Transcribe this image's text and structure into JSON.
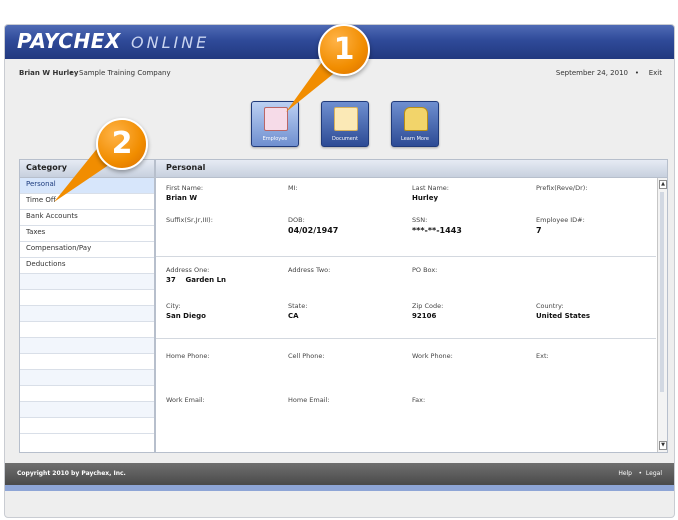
{
  "app": {
    "logo_text": "PAYCHEX",
    "logo_suffix": "ONLINE"
  },
  "userbar": {
    "user": "Brian W Hurley",
    "separator": "•",
    "company": "Sample Training Company",
    "date": "September 24, 2010",
    "exit": "Exit"
  },
  "icons": [
    {
      "label": "Employee",
      "icon": "employee-icon",
      "selected": true
    },
    {
      "label": "Document",
      "icon": "document-icon",
      "selected": false
    },
    {
      "label": "Learn More",
      "icon": "book-icon",
      "selected": false
    }
  ],
  "category": {
    "title": "Category",
    "items": [
      "Personal",
      "Time Off",
      "Bank Accounts",
      "Taxes",
      "Compensation/Pay",
      "Deductions"
    ],
    "selected": "Personal"
  },
  "panel": {
    "title": "Personal",
    "fields": {
      "first_name": {
        "label": "First Name:",
        "value": "Brian W"
      },
      "mi": {
        "label": "MI:",
        "value": ""
      },
      "last_name": {
        "label": "Last Name:",
        "value": "Hurley"
      },
      "prefix": {
        "label": "Prefix(Reve/Dr):",
        "value": ""
      },
      "suffix": {
        "label": "Suffix(Sr,Jr,III):",
        "value": ""
      },
      "dob": {
        "label": "DOB:",
        "value": "04/02/1947"
      },
      "ssn": {
        "label": "SSN:",
        "value": "***-**-1443"
      },
      "employee_id": {
        "label": "Employee ID#:",
        "value": "7"
      },
      "address_one": {
        "label": "Address One:",
        "value": "37    Garden Ln"
      },
      "address_two": {
        "label": "Address Two:",
        "value": ""
      },
      "po_box": {
        "label": "PO Box:",
        "value": ""
      },
      "city": {
        "label": "City:",
        "value": "San Diego"
      },
      "state": {
        "label": "State:",
        "value": "CA"
      },
      "zip": {
        "label": "Zip Code:",
        "value": "92106"
      },
      "country": {
        "label": "Country:",
        "value": "United States"
      },
      "home_phone": {
        "label": "Home Phone:"
      },
      "cell_phone": {
        "label": "Cell Phone:"
      },
      "work_phone": {
        "label": "Work Phone:"
      },
      "ext": {
        "label": "Ext:"
      },
      "work_email": {
        "label": "Work Email:"
      },
      "home_email": {
        "label": "Home Email:"
      },
      "fax": {
        "label": "Fax:"
      }
    }
  },
  "footer": {
    "copyright": "Copyright 2010 by Paychex, Inc.",
    "help": "Help",
    "separator": "•",
    "legal": "Legal"
  },
  "callouts": {
    "one": "1",
    "two": "2"
  },
  "colors": {
    "brand_blue": "#2f4a99",
    "callout_orange": "#f18d00",
    "selected_row": "#d7e6fb"
  }
}
